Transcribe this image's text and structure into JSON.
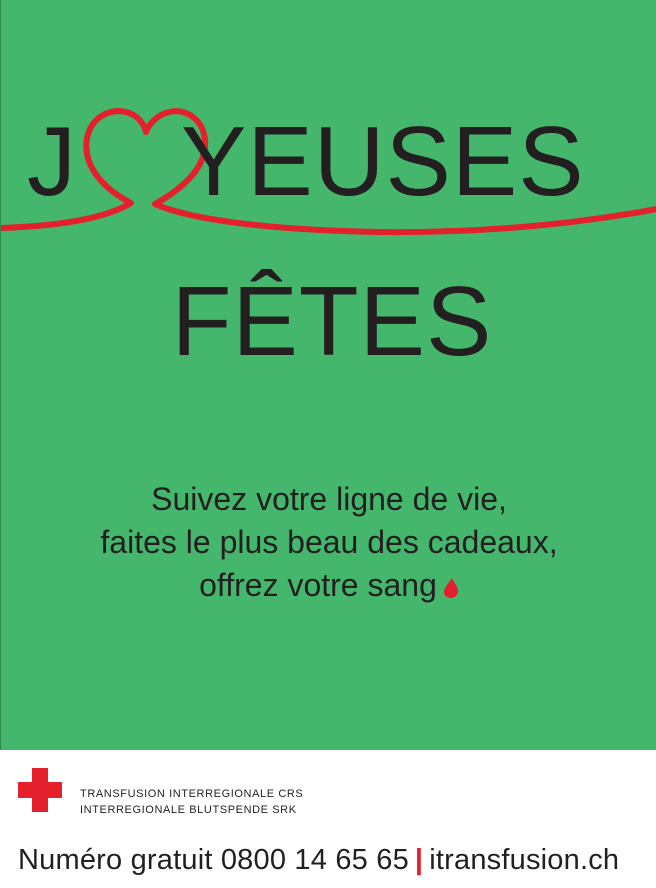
{
  "colors": {
    "background": "#45b76c",
    "accent_red": "#e3202b",
    "text": "#231f20"
  },
  "poster": {
    "title_first_letter": "J",
    "title_heart_icon": "heart-ribbon-icon",
    "title_rest": "YEUSES",
    "title_line2": "FÊTES",
    "tagline_1": "Suivez votre ligne de vie,",
    "tagline_2": "faites le plus beau des cadeaux,",
    "tagline_3": "offrez votre sang",
    "drop_icon": "blood-drop-icon"
  },
  "footer": {
    "logo_icon": "red-cross-icon",
    "org_line_1": "TRANSFUSION INTERREGIONALE CRS",
    "org_line_2": "INTERREGIONALE BLUTSPENDE SRK",
    "phone_text": "Numéro gratuit 0800 14 65 65",
    "separator": "|",
    "website": "itransfusion.ch"
  }
}
